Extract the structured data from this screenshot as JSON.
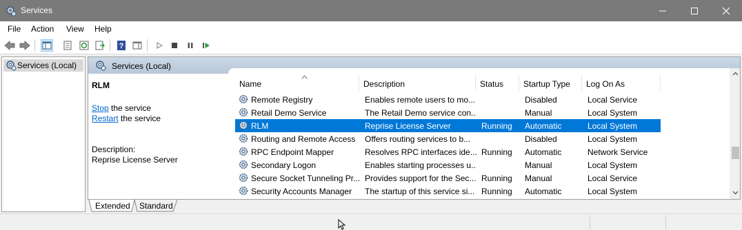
{
  "window": {
    "title": "Services",
    "titlebar_color": "#7a7a7a"
  },
  "menu": {
    "items": [
      "File",
      "Action",
      "View",
      "Help"
    ]
  },
  "toolbar": {
    "icons": [
      "back-arrow-icon",
      "forward-arrow-icon",
      "show-hide-console-tree-icon",
      "properties-icon",
      "refresh-icon",
      "export-list-icon",
      "help-icon",
      "show-action-pane-icon",
      "start-service-icon",
      "stop-service-icon",
      "pause-service-icon",
      "resume-service-icon"
    ]
  },
  "tree": {
    "selected_item": "Services (Local)"
  },
  "detail": {
    "header": "Services (Local)",
    "selected_service": "RLM",
    "actions": [
      {
        "link": "Stop",
        "rest": " the service"
      },
      {
        "link": "Restart",
        "rest": " the service"
      }
    ],
    "description_label": "Description:",
    "description_text": "Reprise License Server"
  },
  "list": {
    "columns": [
      "Name",
      "Description",
      "Status",
      "Startup Type",
      "Log On As"
    ],
    "rows": [
      {
        "name": "Remote Registry",
        "description": "Enables remote users to mo...",
        "status": "",
        "startup": "Disabled",
        "logon": "Local Service",
        "selected": false
      },
      {
        "name": "Retail Demo Service",
        "description": "The Retail Demo service con...",
        "status": "",
        "startup": "Manual",
        "logon": "Local System",
        "selected": false
      },
      {
        "name": "RLM",
        "description": "Reprise License Server",
        "status": "Running",
        "startup": "Automatic",
        "logon": "Local System",
        "selected": true
      },
      {
        "name": "Routing and Remote Access",
        "description": "Offers routing services to b...",
        "status": "",
        "startup": "Disabled",
        "logon": "Local System",
        "selected": false
      },
      {
        "name": "RPC Endpoint Mapper",
        "description": "Resolves RPC interfaces ide...",
        "status": "Running",
        "startup": "Automatic",
        "logon": "Network Service",
        "selected": false
      },
      {
        "name": "Secondary Logon",
        "description": "Enables starting processes u...",
        "status": "",
        "startup": "Manual",
        "logon": "Local System",
        "selected": false
      },
      {
        "name": "Secure Socket Tunneling Pr...",
        "description": "Provides support for the Sec...",
        "status": "Running",
        "startup": "Manual",
        "logon": "Local Service",
        "selected": false
      },
      {
        "name": "Security Accounts Manager",
        "description": "The startup of this service si...",
        "status": "Running",
        "startup": "Automatic",
        "logon": "Local System",
        "selected": false
      }
    ],
    "selection_color": "#0078d7"
  },
  "tabs": [
    "Extended",
    "Standard"
  ]
}
